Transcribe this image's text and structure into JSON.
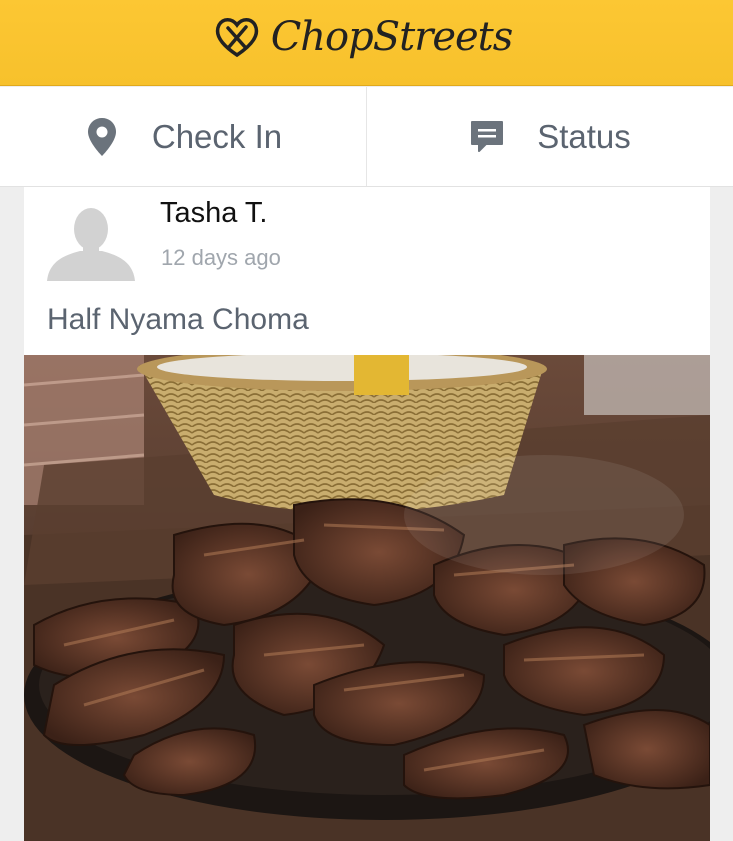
{
  "header": {
    "brand_name": "ChopStreets",
    "logo_icon": "fork-knife-heart-icon",
    "background_color": "#fbc531"
  },
  "actions": [
    {
      "label": "Check In",
      "icon": "location-pin-icon"
    },
    {
      "label": "Status",
      "icon": "chat-bubble-icon"
    }
  ],
  "post": {
    "user_name": "Tasha T.",
    "time_ago": "12 days ago",
    "title": "Half Nyama Choma",
    "photo_subject": "grilled meat on a sizzling platter with a wicker basket"
  }
}
